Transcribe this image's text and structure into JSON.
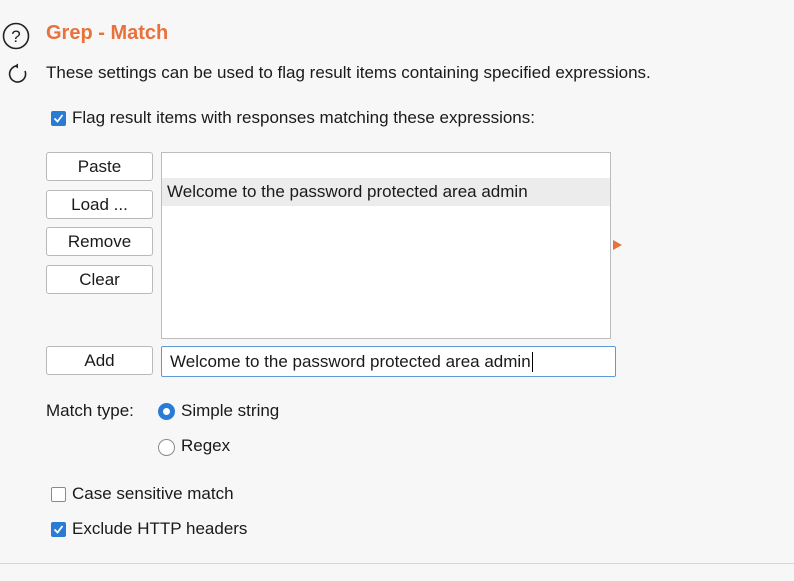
{
  "header": {
    "title": "Grep - Match",
    "description": "These settings can be used to flag result items containing specified expressions."
  },
  "flag_option": {
    "label": "Flag result items with responses matching these expressions:",
    "checked": true
  },
  "buttons": {
    "paste": "Paste",
    "load": "Load ...",
    "remove": "Remove",
    "clear": "Clear",
    "add": "Add"
  },
  "expressions_list": {
    "items": [
      "Welcome to the password protected area admin"
    ],
    "selected_index": 0
  },
  "add_input": {
    "value": "Welcome to the password protected area admin"
  },
  "match_type": {
    "label": "Match type:",
    "options": [
      {
        "label": "Simple string",
        "selected": true
      },
      {
        "label": "Regex",
        "selected": false
      }
    ]
  },
  "case_sensitive": {
    "label": "Case sensitive match",
    "checked": false
  },
  "exclude_headers": {
    "label": "Exclude HTTP headers",
    "checked": true
  },
  "colors": {
    "accent": "#e8713c",
    "checkbox": "#2a7bd4"
  }
}
